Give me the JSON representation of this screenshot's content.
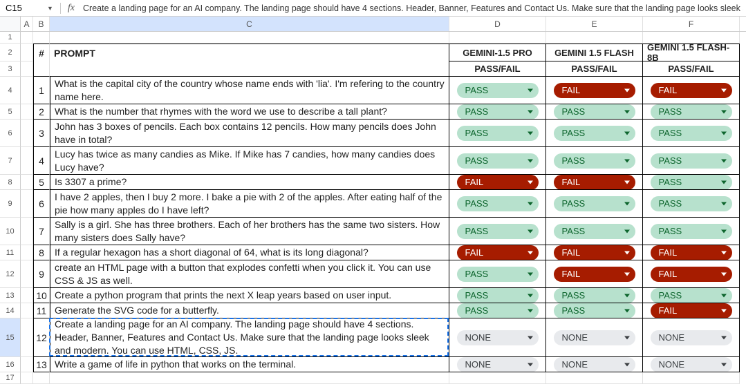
{
  "formula_bar": {
    "cell_ref": "C15",
    "fx_label": "fx",
    "formula_text": "Create a landing page for an AI company. The landing page should have 4 sections. Header, Banner, Features and Contact Us. Make sure that the landing page looks sleek and modern. You"
  },
  "columns": [
    "A",
    "B",
    "C",
    "D",
    "E",
    "F"
  ],
  "headers": {
    "num": "#",
    "prompt": "PROMPT",
    "models": [
      "GEMINI-1.5 PRO",
      "GEMINI 1.5 FLASH",
      "GEMINI 1.5 FLASH-8B"
    ],
    "passfail": "PASS/FAIL"
  },
  "pills": {
    "pass": "PASS",
    "fail": "FAIL",
    "none": "NONE"
  },
  "rows": [
    {
      "n": "1",
      "p": "What is the capital city of the country whose name ends with 'lia'. I'm refering to the country name here.",
      "r": [
        "PASS",
        "FAIL",
        "FAIL"
      ]
    },
    {
      "n": "2",
      "p": "What is the number that rhymes with the word we use to describe a tall plant?",
      "r": [
        "PASS",
        "PASS",
        "PASS"
      ]
    },
    {
      "n": "3",
      "p": "John has 3 boxes of pencils. Each box contains 12 pencils. How many pencils does John have in total?",
      "r": [
        "PASS",
        "PASS",
        "PASS"
      ]
    },
    {
      "n": "4",
      "p": "Lucy has twice as many candies as Mike. If Mike has 7 candies, how many candies does Lucy have?",
      "r": [
        "PASS",
        "PASS",
        "PASS"
      ]
    },
    {
      "n": "5",
      "p": "Is 3307 a prime?",
      "r": [
        "FAIL",
        "FAIL",
        "PASS"
      ]
    },
    {
      "n": "6",
      "p": "I have 2 apples, then I buy 2 more. I bake a pie with 2 of the apples. After eating half of the pie how many apples do I have left?",
      "r": [
        "PASS",
        "PASS",
        "PASS"
      ]
    },
    {
      "n": "7",
      "p": "Sally is a girl. She has three brothers. Each of her brothers has the same two sisters. How many sisters does Sally have?",
      "r": [
        "PASS",
        "PASS",
        "PASS"
      ]
    },
    {
      "n": "8",
      "p": "If a regular hexagon has a short diagonal of 64, what is its long diagonal?",
      "r": [
        "FAIL",
        "FAIL",
        "FAIL"
      ]
    },
    {
      "n": "9",
      "p": "create an HTML page with a button that explodes confetti when you click it. You can use CSS & JS as well.",
      "r": [
        "PASS",
        "FAIL",
        "FAIL"
      ]
    },
    {
      "n": "10",
      "p": "Create a python program that prints the next X leap years based on user input.",
      "r": [
        "PASS",
        "PASS",
        "PASS"
      ]
    },
    {
      "n": "11",
      "p": "Generate the SVG code for a butterfly.",
      "r": [
        "PASS",
        "PASS",
        "FAIL"
      ]
    },
    {
      "n": "12",
      "p": "Create a landing page for an AI company. The landing page should have 4 sections. Header, Banner, Features and Contact Us. Make sure that the landing page looks sleek and modern. You can use HTML, CSS, JS.",
      "r": [
        "NONE",
        "NONE",
        "NONE"
      ]
    },
    {
      "n": "13",
      "p": "Write a game of life in python that works on the terminal.",
      "r": [
        "NONE",
        "NONE",
        "NONE"
      ]
    }
  ],
  "row_numbers": [
    "1",
    "2",
    "3",
    "4",
    "5",
    "6",
    "7",
    "8",
    "9",
    "10",
    "11",
    "12",
    "13",
    "14",
    "15",
    "16",
    "17"
  ],
  "active_row_index": 15
}
